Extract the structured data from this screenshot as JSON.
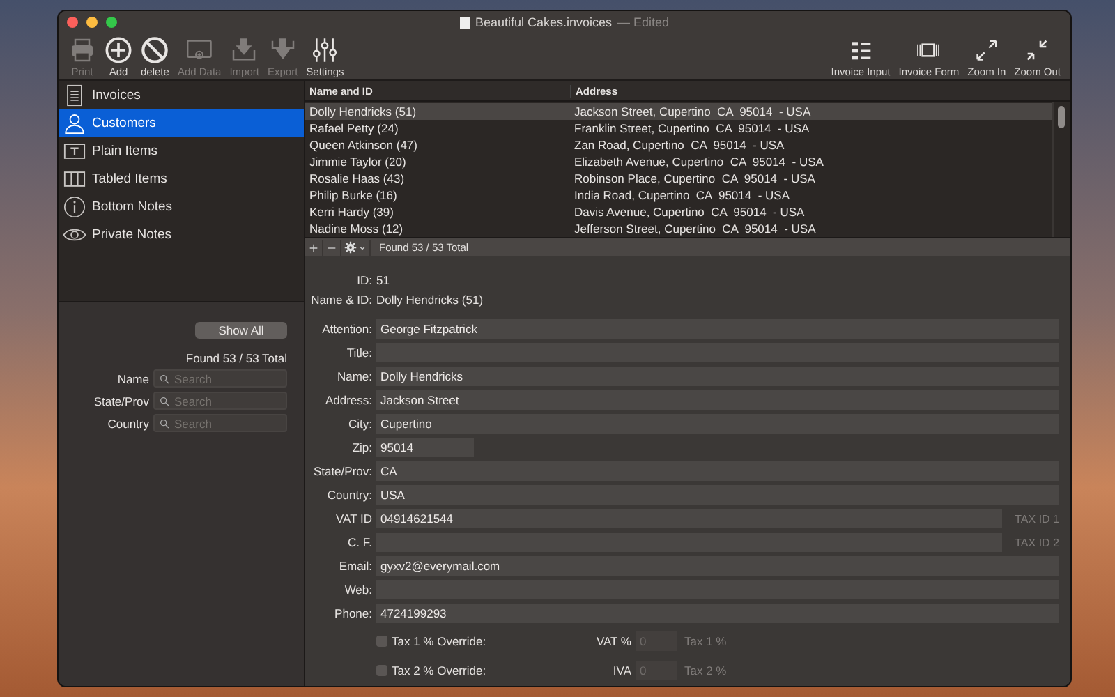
{
  "window": {
    "title": "Beautiful Cakes.invoices",
    "status": "— Edited"
  },
  "toolbar": {
    "left": [
      {
        "label": "Print",
        "disabled": true
      },
      {
        "label": "Add",
        "disabled": false
      },
      {
        "label": "delete",
        "disabled": false
      },
      {
        "label": "Add Data",
        "disabled": true
      },
      {
        "label": "Import",
        "disabled": true
      },
      {
        "label": "Export",
        "disabled": true
      },
      {
        "label": "Settings",
        "disabled": false
      }
    ],
    "right": [
      {
        "label": "Invoice Input",
        "disabled": false
      },
      {
        "label": "Invoice Form",
        "disabled": false
      },
      {
        "label": "Zoom In",
        "disabled": false
      },
      {
        "label": "Zoom Out",
        "disabled": false
      }
    ]
  },
  "sidebar": {
    "items": [
      {
        "label": "Invoices",
        "selected": false
      },
      {
        "label": "Customers",
        "selected": true
      },
      {
        "label": "Plain Items",
        "selected": false
      },
      {
        "label": "Tabled Items",
        "selected": false
      },
      {
        "label": "Bottom Notes",
        "selected": false
      },
      {
        "label": "Private Notes",
        "selected": false
      }
    ]
  },
  "filter": {
    "button": "Show All",
    "found": "Found 53 / 53 Total",
    "fields": [
      {
        "label": "Name",
        "placeholder": "Search"
      },
      {
        "label": "State/Prov",
        "placeholder": "Search"
      },
      {
        "label": "Country",
        "placeholder": "Search"
      }
    ]
  },
  "table": {
    "columns": [
      "Name and ID",
      "Address"
    ],
    "rows": [
      {
        "cells": [
          "Dolly Hendricks (51)",
          "Jackson Street, Cupertino  CA  95014  - USA"
        ],
        "selected": true
      },
      {
        "cells": [
          "Rafael Petty (24)",
          "Franklin Street, Cupertino  CA  95014  - USA"
        ],
        "selected": false
      },
      {
        "cells": [
          "Queen Atkinson (47)",
          "Zan Road, Cupertino  CA  95014  - USA"
        ],
        "selected": false
      },
      {
        "cells": [
          "Jimmie Taylor (20)",
          "Elizabeth Avenue, Cupertino  CA  95014  - USA"
        ],
        "selected": false
      },
      {
        "cells": [
          "Rosalie Haas (43)",
          "Robinson Place, Cupertino  CA  95014  - USA"
        ],
        "selected": false
      },
      {
        "cells": [
          "Philip Burke (16)",
          "India Road, Cupertino  CA  95014  - USA"
        ],
        "selected": false
      },
      {
        "cells": [
          "Kerri Hardy (39)",
          "Davis Avenue, Cupertino  CA  95014  - USA"
        ],
        "selected": false
      },
      {
        "cells": [
          "Nadine Moss (12)",
          "Jefferson Street, Cupertino  CA  95014  - USA"
        ],
        "selected": false
      }
    ],
    "found": "Found 53 / 53 Total"
  },
  "detail": {
    "info": [
      {
        "label": "ID:",
        "value": "51"
      },
      {
        "label": "Name & ID:",
        "value": "Dolly Hendricks (51)"
      }
    ],
    "fields": [
      {
        "label": "Attention:",
        "value": "George Fitzpatrick",
        "kind": "wide"
      },
      {
        "label": "Title:",
        "kind": "wide"
      },
      {
        "label": "Name:",
        "value": "Dolly Hendricks",
        "kind": "wide"
      },
      {
        "label": "Address:",
        "value": "Jackson Street",
        "kind": "wide"
      },
      {
        "label": "City:",
        "value": "Cupertino",
        "kind": "wide"
      },
      {
        "label": "Zip:",
        "value": "95014",
        "kind": "short"
      },
      {
        "label": "State/Prov:",
        "value": "CA",
        "kind": "wide"
      },
      {
        "label": "Country:",
        "value": "USA",
        "kind": "wide"
      },
      {
        "label": "VAT ID",
        "value": "04914621544",
        "kind": "tagged",
        "tag": "TAX ID 1"
      },
      {
        "label": "C. F.",
        "kind": "tagged",
        "tag": "TAX ID 2"
      },
      {
        "label": "Email:",
        "value": "gyxv2@everymail.com",
        "kind": "wide"
      },
      {
        "label": "Web:",
        "kind": "wide"
      },
      {
        "label": "Phone:",
        "value": "4724199293",
        "kind": "wide"
      }
    ],
    "overrides": [
      {
        "label": "Tax 1 % Override:",
        "checked": false,
        "rate_label": "VAT %",
        "placeholder": "0",
        "hint": "Tax 1 %"
      },
      {
        "label": "Tax 2 % Override:",
        "checked": false,
        "rate_label": "IVA",
        "placeholder": "0",
        "hint": "Tax 2 %"
      }
    ]
  }
}
